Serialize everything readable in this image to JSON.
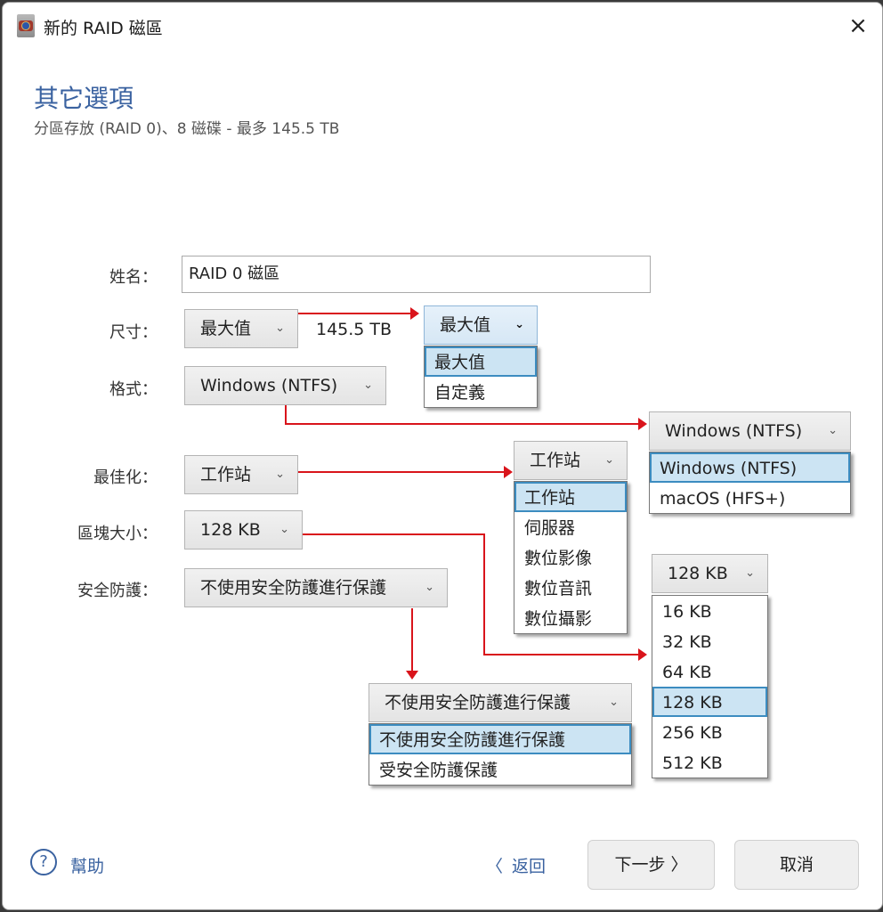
{
  "window": {
    "title": "新的 RAID 磁區",
    "close_icon": "×"
  },
  "header": {
    "title": "其它選項",
    "subtitle": "分區存放 (RAID 0)、8 磁碟 - 最多 145.5 TB"
  },
  "form": {
    "name": {
      "label": "姓名：",
      "value": "RAID 0 磁區"
    },
    "size": {
      "label": "尺寸：",
      "value": "最大值",
      "capacity": "145.5 TB"
    },
    "format": {
      "label": "格式：",
      "value": "Windows (NTFS)"
    },
    "optimize": {
      "label": "最佳化：",
      "value": "工作站"
    },
    "block_size": {
      "label": "區塊大小：",
      "value": "128 KB"
    },
    "security": {
      "label": "安全防護：",
      "value": "不使用安全防護進行保護"
    }
  },
  "dropdowns": {
    "size": {
      "value": "最大值",
      "options": [
        "最大值",
        "自定義"
      ],
      "selected": 0
    },
    "format": {
      "value": "Windows (NTFS)",
      "options": [
        "Windows (NTFS)",
        "macOS (HFS+)"
      ],
      "selected": 0
    },
    "optimize": {
      "value": "工作站",
      "options": [
        "工作站",
        "伺服器",
        "數位影像",
        "數位音訊",
        "數位攝影"
      ],
      "selected": 0
    },
    "block_size": {
      "value": "128 KB",
      "options": [
        "16 KB",
        "32 KB",
        "64 KB",
        "128 KB",
        "256 KB",
        "512 KB"
      ],
      "selected": 3
    },
    "security": {
      "value": "不使用安全防護進行保護",
      "options": [
        "不使用安全防護進行保護",
        "受安全防護保護"
      ],
      "selected": 0
    }
  },
  "chevron": "⌄",
  "footer": {
    "help_icon": "?",
    "help_label": "幫助",
    "back_chevron": "〈",
    "back_label": "返回",
    "next_label": "下一步 〉",
    "cancel_label": "取消"
  },
  "colors": {
    "accent": "#3a62a0",
    "annotation_arrow": "#d9141b",
    "selected_option_bg": "#cce4f3",
    "selected_option_border": "#3c8cc0"
  }
}
